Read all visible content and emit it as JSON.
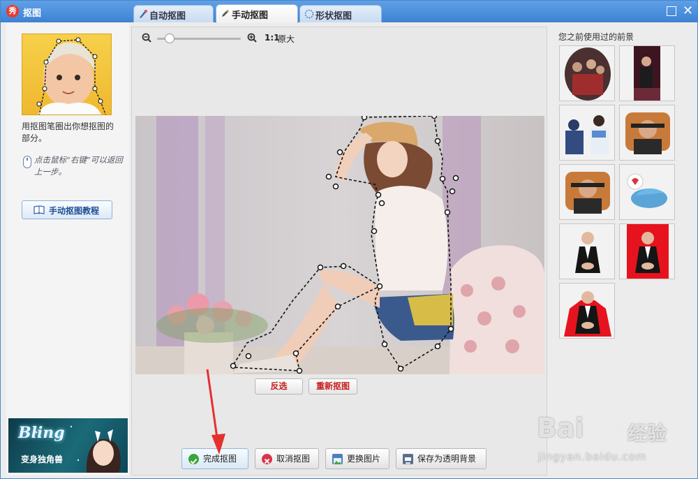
{
  "window": {
    "title": "抠图",
    "logo_glyph": "秀"
  },
  "tabs": [
    {
      "label": "自动抠图",
      "icon": "brush-icon",
      "active": false
    },
    {
      "label": "手动抠图",
      "icon": "pen-icon",
      "active": true
    },
    {
      "label": "形状抠图",
      "icon": "shape-icon",
      "active": false
    }
  ],
  "left_panel": {
    "instruction": "用抠图笔圈出你想抠图的部分。",
    "tip": "点击鼠标“右键”可以返回上一步。",
    "tutorial_button": "手动抠图教程",
    "promo": {
      "title": "Bling",
      "subtitle": "变身独角兽"
    }
  },
  "toolbar": {
    "ratio_label": "1:1",
    "original_label": "原大",
    "zoom_level": 0.1
  },
  "canvas_buttons": {
    "invert": "反选",
    "redo": "重新抠图"
  },
  "actions": {
    "finish": "完成抠图",
    "cancel": "取消抠图",
    "replace": "更换图片",
    "save": "保存为透明背景"
  },
  "right_panel": {
    "title": "您之前使用过的前景",
    "thumbnail_count": 9
  },
  "watermark": {
    "brand": "Bai",
    "brand_cn": "经验",
    "url": "jingyan.baidu.com"
  },
  "colors": {
    "titlebar": "#3d82d4",
    "accent_red": "#c81d1d",
    "window_bg": "#ececec"
  }
}
